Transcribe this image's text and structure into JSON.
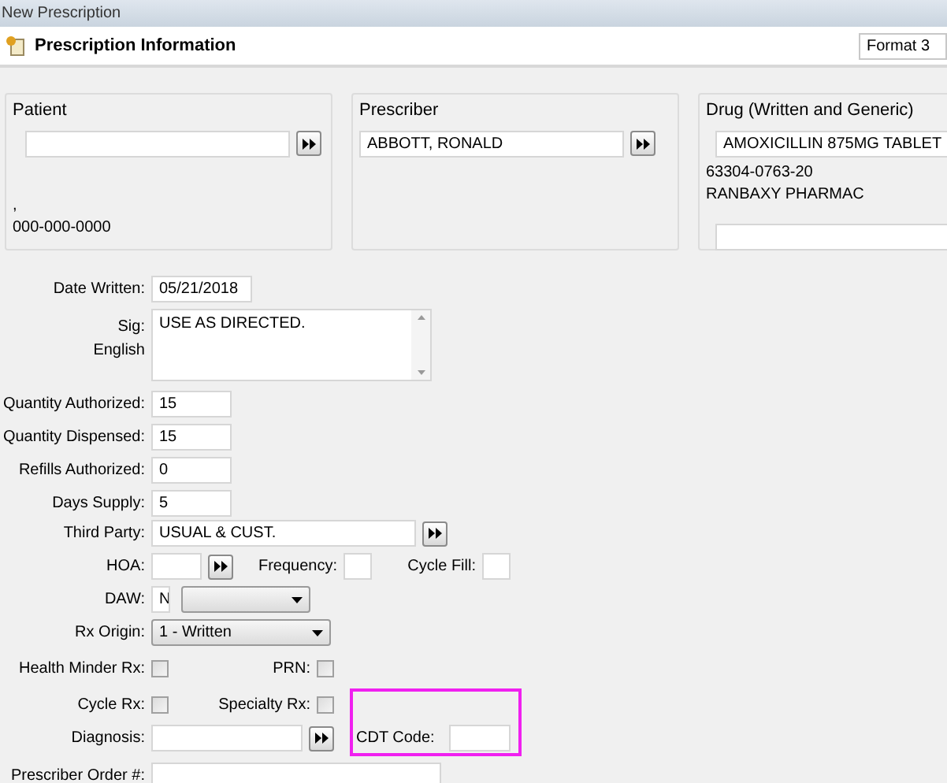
{
  "window": {
    "title": "New Prescription"
  },
  "header": {
    "title": "Prescription Information",
    "format": "Format 3"
  },
  "patient": {
    "label": "Patient",
    "lines": [
      ",",
      "000-000-0000"
    ]
  },
  "prescriber": {
    "label": "Prescriber",
    "value": "ABBOTT, RONALD"
  },
  "drug": {
    "label": "Drug (Written and Generic)",
    "value": "AMOXICILLIN 875MG TABLET",
    "lines": [
      "63304-0763-20",
      "RANBAXY PHARMAC"
    ]
  },
  "date_written": {
    "label": "Date Written:",
    "value": "05/21/2018"
  },
  "sig": {
    "label": "Sig:",
    "language": "English",
    "value": "USE AS DIRECTED."
  },
  "quantities": [
    {
      "label": "Quantity Authorized:",
      "value": "15"
    },
    {
      "label": "Quantity Dispensed:",
      "value": "15"
    },
    {
      "label": "Refills Authorized:",
      "value": "0"
    },
    {
      "label": "Days Supply:",
      "value": "5"
    }
  ],
  "third_party": {
    "label": "Third Party:",
    "value": "USUAL & CUST."
  },
  "hoa": {
    "label": "HOA:",
    "frequency_label": "Frequency:",
    "cycle_fill_label": "Cycle Fill:"
  },
  "daw": {
    "label": "DAW:",
    "value": "N"
  },
  "rx_origin": {
    "label": "Rx Origin:",
    "value": "1 - Written"
  },
  "checkboxes": [
    {
      "label": "Health Minder Rx:",
      "checked": false
    },
    {
      "label": "PRN:",
      "checked": false
    },
    {
      "label": "Cycle Rx:",
      "checked": false
    },
    {
      "label": "Specialty Rx:",
      "checked": false
    }
  ],
  "diagnosis": {
    "label": "Diagnosis:",
    "cdt_label": "CDT Code:"
  },
  "prescriber_order": {
    "label": "Prescriber Order #:"
  }
}
